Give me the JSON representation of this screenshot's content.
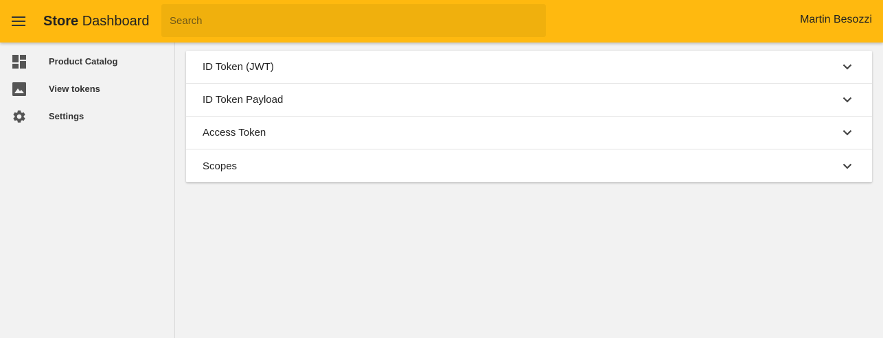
{
  "header": {
    "brand_strong": "Store",
    "brand_light": "Dashboard",
    "search_placeholder": "Search",
    "user_name": "Martin Besozzi",
    "accent_color": "#ffb90f"
  },
  "sidebar": {
    "items": [
      {
        "icon": "dashboard-icon",
        "label": "Product Catalog"
      },
      {
        "icon": "image-icon",
        "label": "View tokens"
      },
      {
        "icon": "gear-icon",
        "label": "Settings"
      }
    ]
  },
  "main": {
    "panels": [
      {
        "title": "ID Token (JWT)",
        "expanded": false
      },
      {
        "title": "ID Token Payload",
        "expanded": false
      },
      {
        "title": "Access Token",
        "expanded": false
      },
      {
        "title": "Scopes",
        "expanded": false
      }
    ]
  }
}
